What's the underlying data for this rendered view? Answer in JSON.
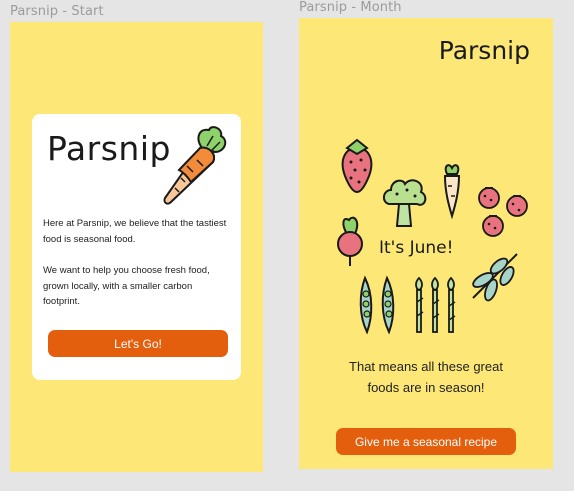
{
  "frames": {
    "start": {
      "label": "Parsnip - Start"
    },
    "month": {
      "label": "Parsnip - Month"
    }
  },
  "start_screen": {
    "brand": "Parsnip",
    "intro_p1": "Here at Parsnip, we believe that the tastiest food is seasonal food.",
    "intro_p2": "We want to help you choose fresh food, grown locally, with a smaller carbon footprint.",
    "cta_label": "Let's Go!"
  },
  "month_screen": {
    "brand": "Parsnip",
    "month_heading": "It's June!",
    "season_line1": "That means all these great",
    "season_line2": "foods are in season!",
    "cta_label": "Give me a seasonal recipe"
  },
  "colors": {
    "background": "#fde877",
    "accent": "#e35f0e",
    "card": "#ffffff"
  },
  "icons": [
    "carrot-icon",
    "strawberry-icon",
    "broccoli-icon",
    "parsnip-icon",
    "raspberries-icon",
    "radish-icon",
    "peas-icon",
    "asparagus-icon",
    "herb-branch-icon"
  ]
}
